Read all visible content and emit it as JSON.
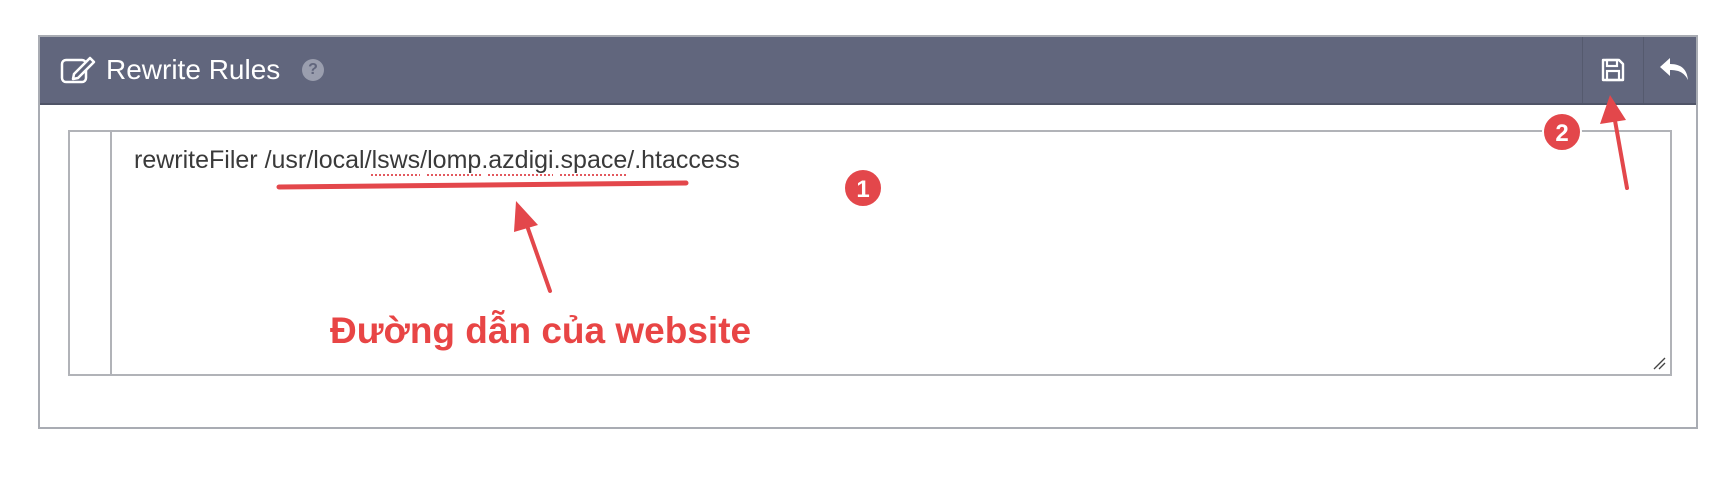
{
  "panel": {
    "title": "Rewrite Rules",
    "help_icon": "?",
    "header_icons": {
      "edit": "edit-icon",
      "save": "save-icon",
      "back": "undo-icon"
    }
  },
  "editor": {
    "line_prefix": "rewriteFiler ",
    "path_start": "/usr/local/",
    "path_word_1": "lsws",
    "path_mid": "/",
    "path_word_2": "lomp",
    "path_dot_1": ".",
    "path_word_3": "azdigi",
    "path_dot_2": ".",
    "path_word_4": "space",
    "path_end": "/.htaccess"
  },
  "annotations": {
    "label": "Đường dẫn của website",
    "badge_1": "1",
    "badge_2": "2",
    "color": "#e84545"
  },
  "colors": {
    "header_bg": "#61667d",
    "accent_red": "#e3474b"
  }
}
